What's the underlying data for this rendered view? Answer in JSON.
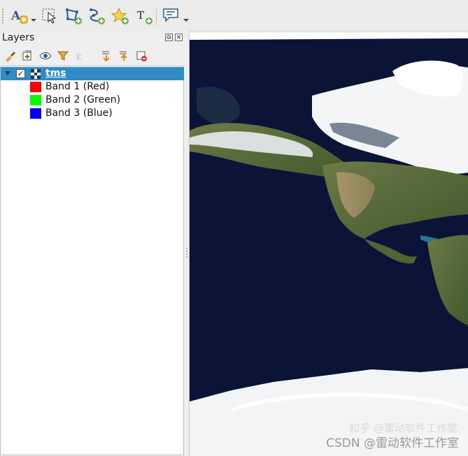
{
  "toolbar": {
    "buttons": [
      {
        "name": "label-tool-icon",
        "has_dropdown": true
      },
      {
        "name": "select-features-icon",
        "has_dropdown": false
      },
      {
        "name": "add-polygon-icon",
        "has_dropdown": false
      },
      {
        "name": "add-line-icon",
        "has_dropdown": false
      },
      {
        "name": "add-star-icon",
        "has_dropdown": false
      },
      {
        "name": "add-text-icon",
        "has_dropdown": false
      },
      {
        "name": "annotation-icon",
        "has_dropdown": true
      }
    ]
  },
  "layers_panel": {
    "title": "Layers",
    "toolbar_icons": [
      "style-brush-icon",
      "add-group-icon",
      "visibility-eye-icon",
      "filter-icon",
      "expression-filter-icon",
      "expand-all-icon",
      "collapse-all-icon",
      "remove-layer-icon"
    ],
    "layer": {
      "name": "tms",
      "checked": true,
      "expanded": true,
      "checkmark": "✓",
      "bands": [
        {
          "label": "Band 1 (Red)",
          "color": "#ff0000"
        },
        {
          "label": "Band 2 (Green)",
          "color": "#00ff00"
        },
        {
          "label": "Band 3 (Blue)",
          "color": "#0000ff"
        }
      ]
    }
  },
  "map": {
    "content": "satellite imagery of the Americas",
    "watermark_top": "知乎 @雷动软件工作室",
    "watermark": "CSDN @雷动软件工作室"
  },
  "colors": {
    "selection": "#308cc6",
    "ocean": "#0b1437",
    "land": "#5a6b3a",
    "ice": "#f2f4f6"
  }
}
